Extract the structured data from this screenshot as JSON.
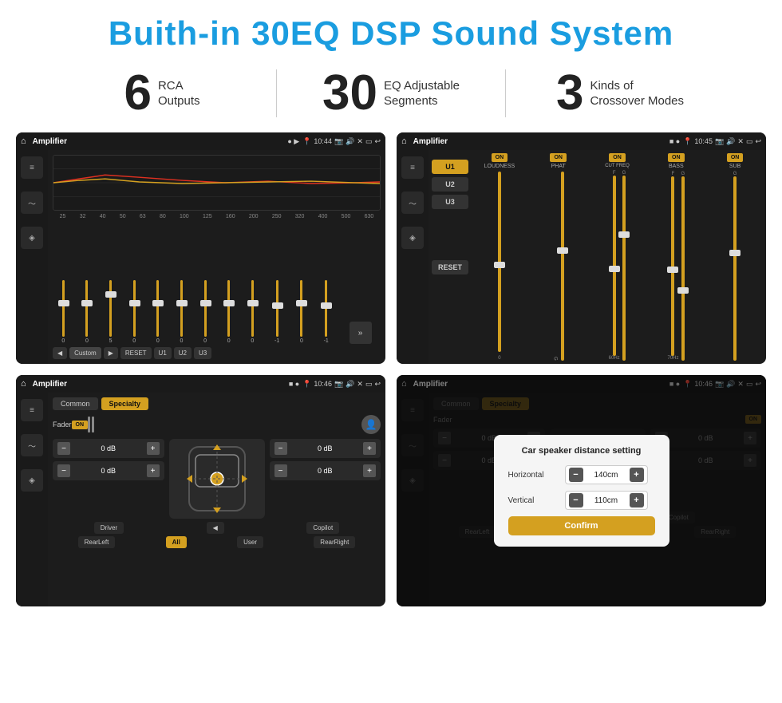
{
  "header": {
    "title": "Buith-in 30EQ DSP Sound System"
  },
  "stats": [
    {
      "number": "6",
      "label": "RCA\nOutputs"
    },
    {
      "number": "30",
      "label": "EQ Adjustable\nSegments"
    },
    {
      "number": "3",
      "label": "Kinds of\nCrossover Modes"
    }
  ],
  "screens": {
    "eq": {
      "status_bar": {
        "app": "Amplifier",
        "time": "10:44"
      },
      "freq_bands": [
        "25",
        "32",
        "40",
        "50",
        "63",
        "80",
        "100",
        "125",
        "160",
        "200",
        "250",
        "320",
        "400",
        "500",
        "630"
      ],
      "values": [
        "0",
        "0",
        "0",
        "5",
        "0",
        "0",
        "0",
        "0",
        "0",
        "0",
        "0",
        "-1",
        "0",
        "-1"
      ],
      "preset": "Custom",
      "buttons": [
        "RESET",
        "U1",
        "U2",
        "U3"
      ]
    },
    "crossover": {
      "status_bar": {
        "app": "Amplifier",
        "time": "10:45"
      },
      "presets": [
        "U1",
        "U2",
        "U3"
      ],
      "channels": [
        {
          "toggle": "ON",
          "label": "LOUDNESS"
        },
        {
          "toggle": "ON",
          "label": "PHAT"
        },
        {
          "toggle": "ON",
          "label": "CUT FREQ"
        },
        {
          "toggle": "ON",
          "label": "BASS"
        },
        {
          "toggle": "ON",
          "label": "SUB"
        }
      ],
      "reset": "RESET"
    },
    "fader": {
      "status_bar": {
        "app": "Amplifier",
        "time": "10:46"
      },
      "tabs": [
        "Common",
        "Specialty"
      ],
      "active_tab": "Specialty",
      "fader_label": "Fader",
      "fader_on": "ON",
      "db_rows": [
        {
          "val1": "0 dB",
          "val2": "0 dB"
        },
        {
          "val1": "0 dB",
          "val2": "0 dB"
        }
      ],
      "bottom_buttons": [
        "Driver",
        "",
        "Copilot",
        "RearLeft",
        "All",
        "User",
        "RearRight"
      ]
    },
    "dialog": {
      "status_bar": {
        "app": "Amplifier",
        "time": "10:46"
      },
      "tabs": [
        "Common",
        "Specialty"
      ],
      "active_tab": "Specialty",
      "fader_on": "ON",
      "dialog": {
        "title": "Car speaker distance setting",
        "rows": [
          {
            "label": "Horizontal",
            "value": "140cm"
          },
          {
            "label": "Vertical",
            "value": "110cm"
          }
        ],
        "confirm": "Confirm"
      },
      "db_rows": [
        {
          "val": "0 dB"
        },
        {
          "val": "0 dB"
        }
      ],
      "bottom_buttons": [
        "Driver",
        "Copilot",
        "RearLeft",
        "User",
        "RearRight"
      ]
    }
  }
}
